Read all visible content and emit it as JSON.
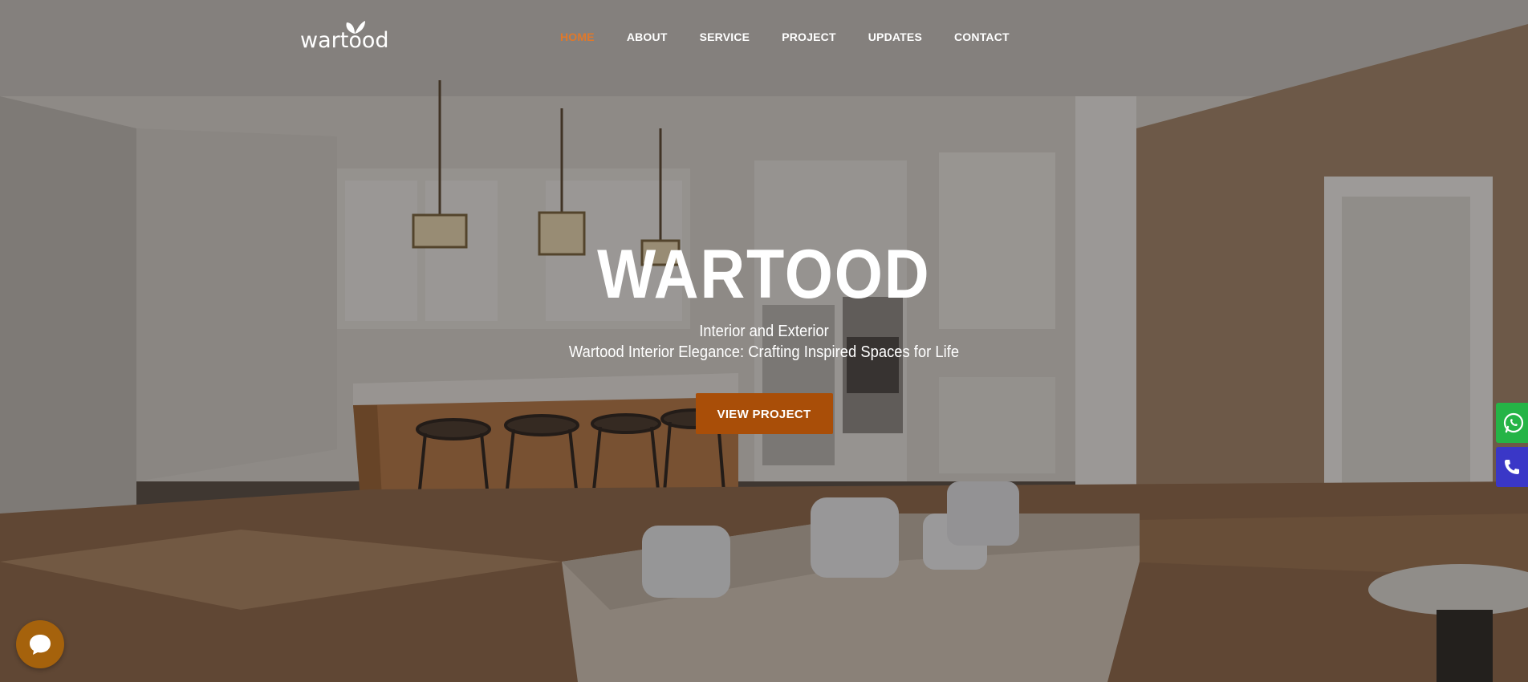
{
  "brand": {
    "logo_text": "wartood"
  },
  "nav": {
    "items": [
      {
        "label": "HOME",
        "active": true
      },
      {
        "label": "ABOUT",
        "active": false
      },
      {
        "label": "SERVICE",
        "active": false
      },
      {
        "label": "PROJECT",
        "active": false
      },
      {
        "label": "UPDATES",
        "active": false
      },
      {
        "label": "CONTACT",
        "active": false
      }
    ]
  },
  "hero": {
    "title": "WARTOOD",
    "subtitle_line1": "Interior and Exterior",
    "subtitle_line2": "Wartood Interior Elegance: Crafting Inspired Spaces for Life",
    "cta_label": "VIEW PROJECT"
  },
  "floating": {
    "whatsapp_icon": "whatsapp-icon",
    "phone_icon": "phone-icon",
    "chat_icon": "chat-icon"
  },
  "colors": {
    "accent": "#e0782a",
    "cta": "#a94e08",
    "whatsapp": "#25b446",
    "phone": "#3a37c7",
    "chat": "#a5620c"
  }
}
